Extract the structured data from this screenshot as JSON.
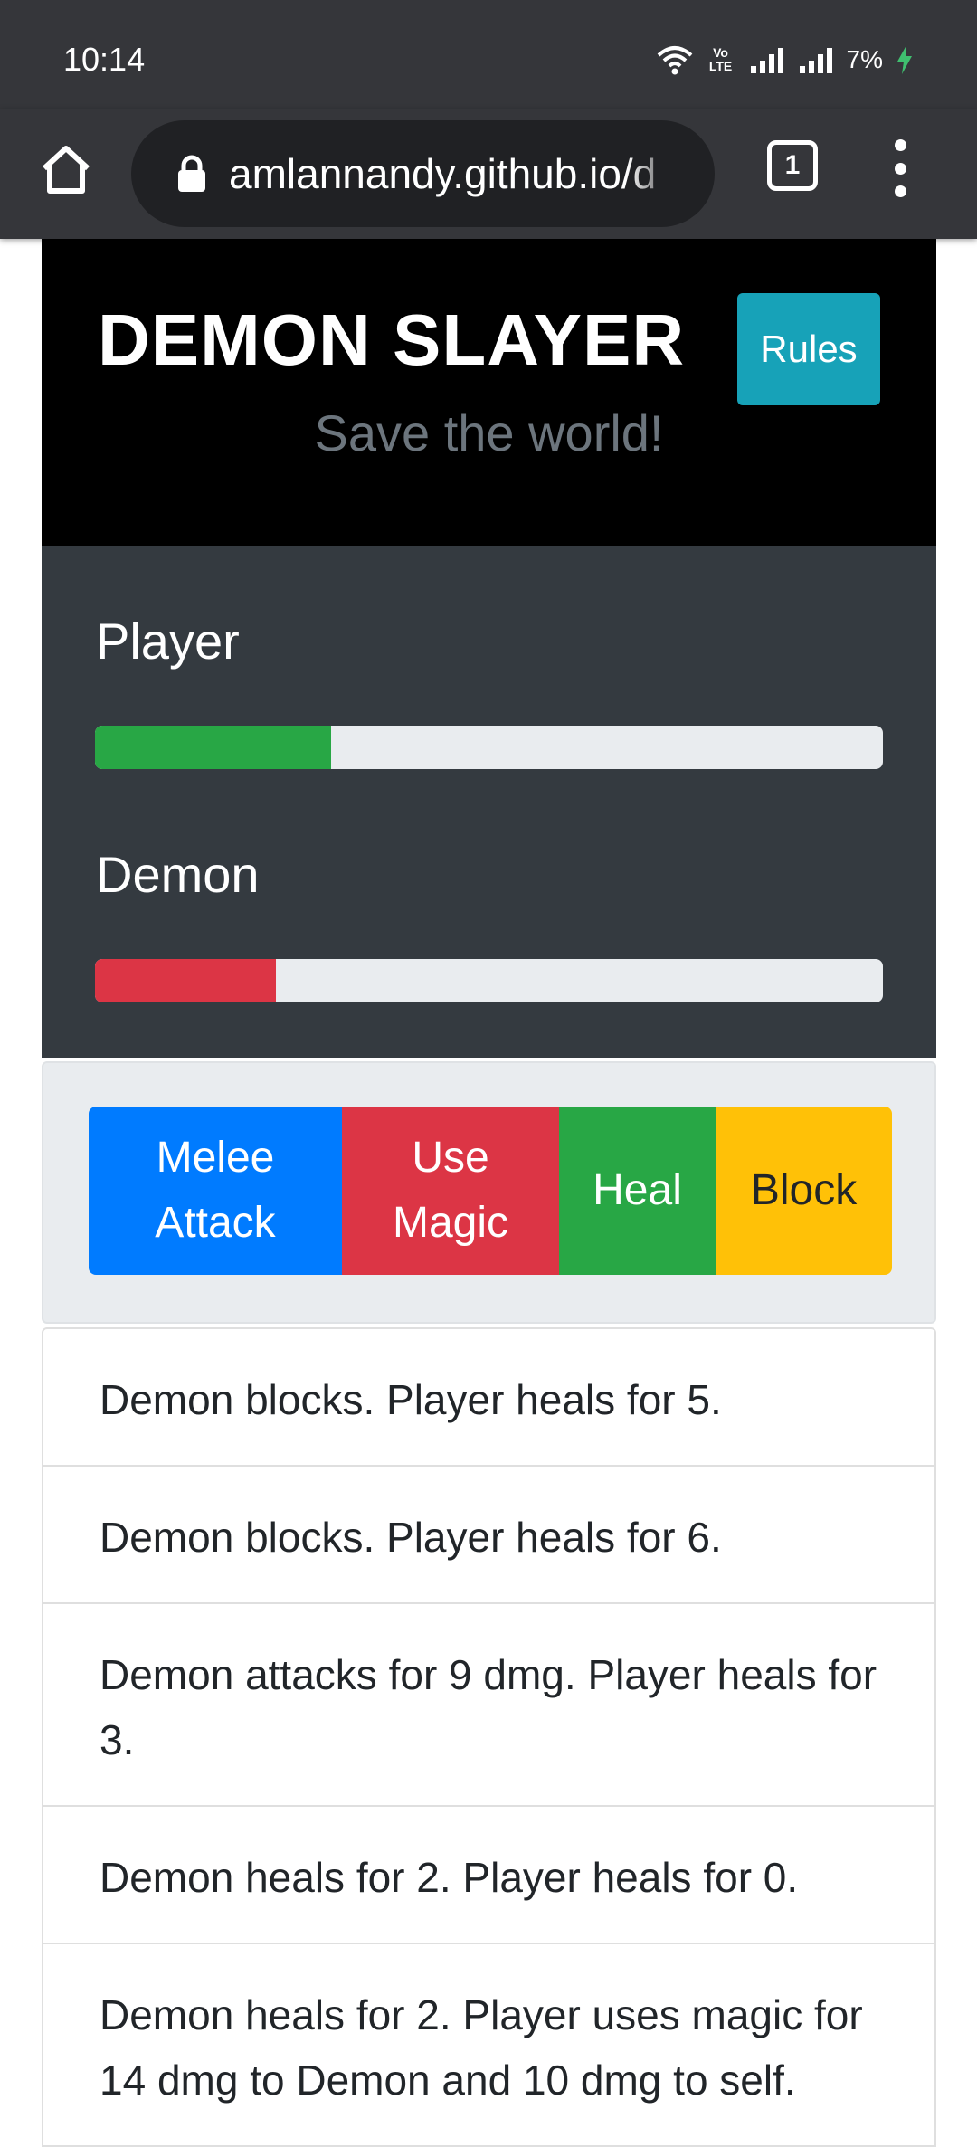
{
  "status_bar": {
    "time": "10:14",
    "volte_label": "Vo))\nLTE2",
    "battery": "7%"
  },
  "browser": {
    "url": "amlannandy.github.io/d",
    "tab_count": "1"
  },
  "header": {
    "title": "DEMON SLAYER",
    "subtitle": "Save the world!",
    "rules_label": "Rules"
  },
  "health": {
    "player_label": "Player",
    "player_fraction": 0.3,
    "demon_label": "Demon",
    "demon_fraction": 0.23
  },
  "actions": {
    "melee_line1": "Melee",
    "melee_line2": "Attack",
    "magic_line1": "Use",
    "magic_line2": "Magic",
    "heal": "Heal",
    "block": "Block"
  },
  "log": [
    "Demon blocks. Player heals for 5.",
    "Demon blocks. Player heals for 6.",
    "Demon attacks for 9 dmg. Player heals for 3.",
    "Demon heals for 2. Player heals for 0.",
    "Demon heals for 2. Player uses magic for 14 dmg to Demon and 10 dmg to self."
  ],
  "colors": {
    "player_bar": "#28a745",
    "demon_bar": "#dc3545",
    "rules_button": "#17a2b8",
    "melee_button": "#007bff",
    "magic_button": "#dc3545",
    "heal_button": "#28a745",
    "block_button": "#ffc107"
  }
}
